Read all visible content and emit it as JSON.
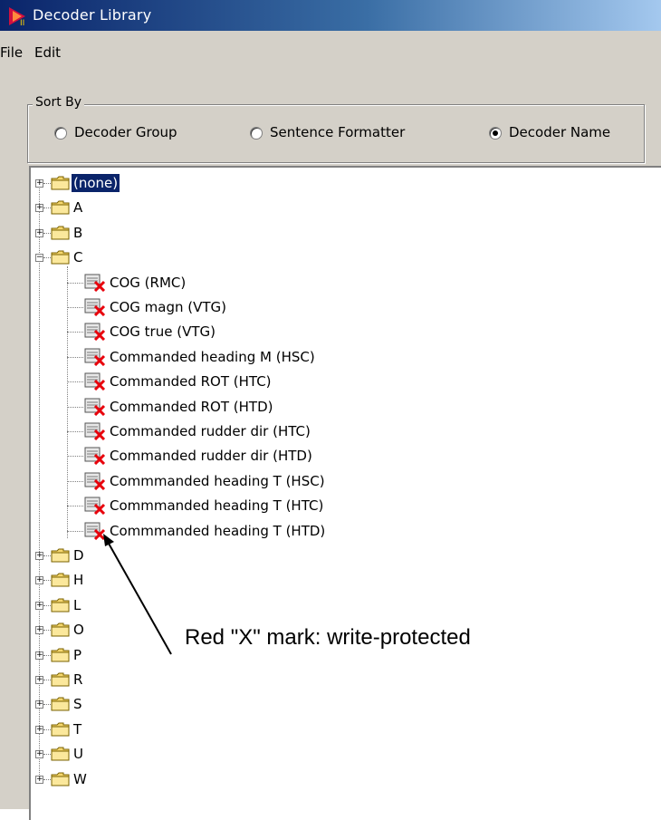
{
  "window": {
    "title": "Decoder Library"
  },
  "menu": [
    "File",
    "Edit"
  ],
  "sort_by": {
    "label": "Sort By",
    "options": [
      {
        "label": "Decoder Group",
        "selected": false
      },
      {
        "label": "Sentence Formatter",
        "selected": false
      },
      {
        "label": "Decoder Name",
        "selected": true
      }
    ]
  },
  "tree": {
    "root": {
      "label": "(none)",
      "expander": "+",
      "selected": true
    },
    "groups_before": [
      {
        "label": "A",
        "expander": "+"
      },
      {
        "label": "B",
        "expander": "+"
      },
      {
        "label": "C",
        "expander": "−"
      }
    ],
    "c_children": [
      "COG (RMC)",
      "COG magn (VTG)",
      "COG true (VTG)",
      "Commanded heading M (HSC)",
      "Commanded ROT (HTC)",
      "Commanded ROT (HTD)",
      "Commanded rudder dir (HTC)",
      "Commanded rudder dir (HTD)",
      "Commmanded heading T (HSC)",
      "Commmanded heading T (HTC)",
      "Commmanded heading T (HTD)"
    ],
    "groups_after": [
      {
        "label": "D",
        "expander": "+"
      },
      {
        "label": "H",
        "expander": "+"
      },
      {
        "label": "L",
        "expander": "+"
      },
      {
        "label": "O",
        "expander": "+"
      },
      {
        "label": "P",
        "expander": "+"
      },
      {
        "label": "R",
        "expander": "+"
      },
      {
        "label": "S",
        "expander": "+"
      },
      {
        "label": "T",
        "expander": "+"
      },
      {
        "label": "U",
        "expander": "+"
      },
      {
        "label": "W",
        "expander": "+"
      }
    ]
  },
  "annotation": {
    "text": "Red \"X\" mark: write-protected"
  },
  "colors": {
    "title_bar": "#0a246a",
    "window_bg": "#d4d0c8",
    "folder": "#f5d76e",
    "write_protect_mark": "#e8000b"
  },
  "icons": {
    "folder": "folder-icon",
    "decoder": "decoder-document-icon",
    "protected": "red-x-icon"
  }
}
